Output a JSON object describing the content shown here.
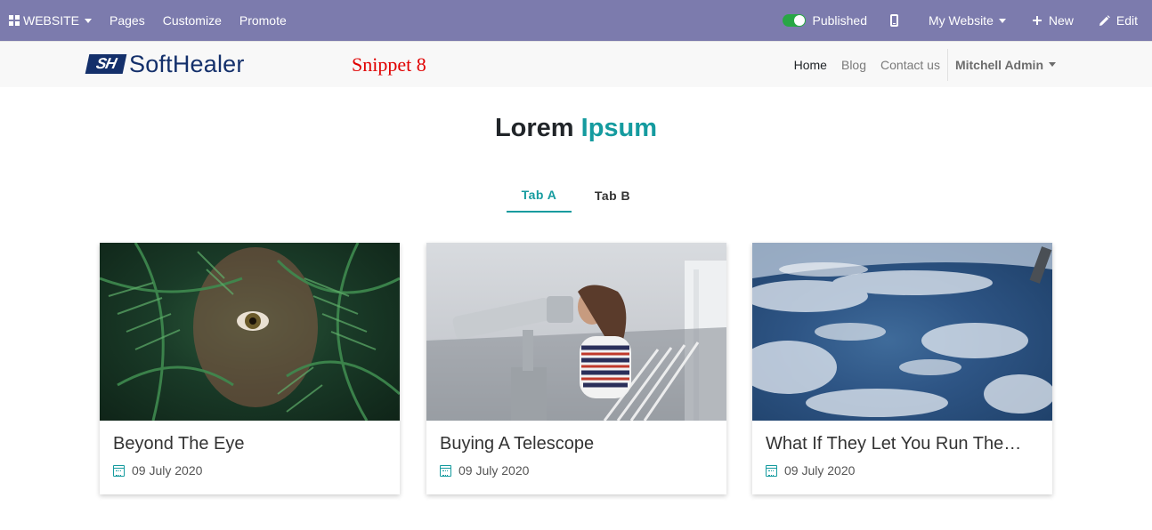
{
  "adminbar": {
    "apps_label": "WEBSITE",
    "menu": [
      "Pages",
      "Customize",
      "Promote"
    ],
    "published_label": "Published",
    "website_label": "My Website",
    "new_label": "New",
    "edit_label": "Edit"
  },
  "header": {
    "logo_mark": "SH",
    "logo_text": "SoftHealer",
    "snippet_label": "Snippet 8",
    "nav": [
      "Home",
      "Blog",
      "Contact us"
    ],
    "user": "Mitchell Admin"
  },
  "section": {
    "title_main": "Lorem",
    "title_accent": "Ipsum"
  },
  "tabs": [
    "Tab A",
    "Tab B"
  ],
  "cards": [
    {
      "title": "Beyond The Eye",
      "date": "09 July 2020",
      "image": "fern-eye-photo"
    },
    {
      "title": "Buying A Telescope",
      "date": "09 July 2020",
      "image": "telescope-photo"
    },
    {
      "title": "What If They Let You Run The…",
      "date": "09 July 2020",
      "image": "earth-clouds-photo"
    }
  ],
  "colors": {
    "adminbar": "#7c7bad",
    "accent": "#159b9f",
    "logo": "#14306b",
    "snippet": "#e00000"
  }
}
